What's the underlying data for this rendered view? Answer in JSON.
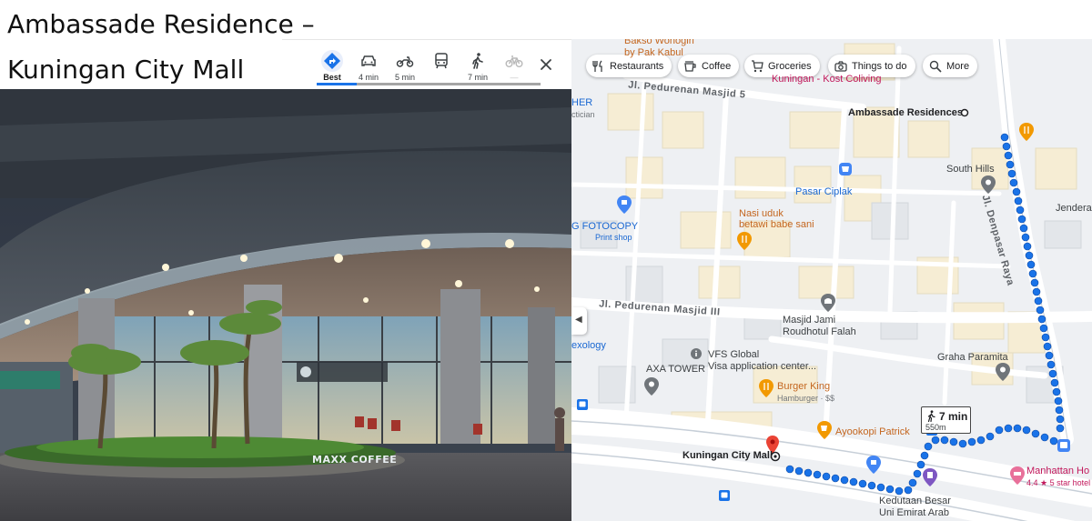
{
  "slide": {
    "title_line1": "Ambassade Residence –",
    "title_line2": "Kuningan City Mall"
  },
  "photo": {
    "storefront_sign": "MAXX COFFEE"
  },
  "travel_modes": {
    "selected": "best",
    "items": [
      {
        "id": "best",
        "icon": "directions-icon",
        "label": "Best"
      },
      {
        "id": "drive",
        "icon": "car-icon",
        "label": "4 min"
      },
      {
        "id": "motorcycle",
        "icon": "motorcycle-icon",
        "label": "5 min"
      },
      {
        "id": "transit",
        "icon": "transit-icon",
        "label": ""
      },
      {
        "id": "walk",
        "icon": "walk-icon",
        "label": "7 min"
      },
      {
        "id": "bicycle",
        "icon": "bicycle-icon",
        "label": "—"
      }
    ],
    "close_icon": "close-icon"
  },
  "map": {
    "chips": [
      {
        "icon": "restaurant-icon",
        "label": "Restaurants"
      },
      {
        "icon": "coffee-icon",
        "label": "Coffee"
      },
      {
        "icon": "cart-icon",
        "label": "Groceries"
      },
      {
        "icon": "camera-icon",
        "label": "Things to do"
      },
      {
        "icon": "search-icon",
        "label": "More"
      }
    ],
    "places": {
      "ambassade": "Ambassade Residences",
      "south_hills": "South Hills",
      "jenderal": "Jenderal",
      "pasar_ciplak": "Pasar Ciplak",
      "nasi_uduk_1": "Nasi uduk",
      "nasi_uduk_2": "betawi babe sani",
      "fotocopy": "G FOTOCOPY",
      "fotocopy_sub": "Print shop",
      "masjid_1": "Masjid Jami",
      "masjid_2": "Roudhotul Falah",
      "graha": "Graha Paramita",
      "vfs_1": "VFS Global",
      "vfs_2": "Visa application center...",
      "axa": "AXA TOWER",
      "burger_king": "Burger King",
      "burger_king_sub": "Hamburger · $$",
      "ayookopi": "Ayookopi Patrick",
      "kuningan": "Kuningan City Mall",
      "manhattan": "Manhattan Ho",
      "manhattan_sub": "4.4 ★ 5 star hotel",
      "kedutaan_1": "Kedutaan Besar",
      "kedutaan_2": "Uni Emirat Arab",
      "exology": "exology",
      "her": "HER",
      "her_sub": "ctician",
      "bakso_1": "Bakso Wonogiri",
      "bakso_2": "by Pak Kabul",
      "kost": "Kuningan - Kost Coliving"
    },
    "roads": {
      "pedurenan_5": "Jl. Pedurenan Masjid 5",
      "pedurenan_3": "Jl. Pedurenan Masjid III",
      "denpasar": "Jl. Denpasar Raya"
    },
    "eta": {
      "time": "7 min",
      "distance": "550m"
    },
    "colors": {
      "route": "#1a73e8",
      "destination_pin": "#ea4335",
      "food_poi": "#f29900",
      "shop_poi": "#4285f4",
      "landmark_poi": "#70757a",
      "hotel_poi": "#e8709a"
    }
  }
}
